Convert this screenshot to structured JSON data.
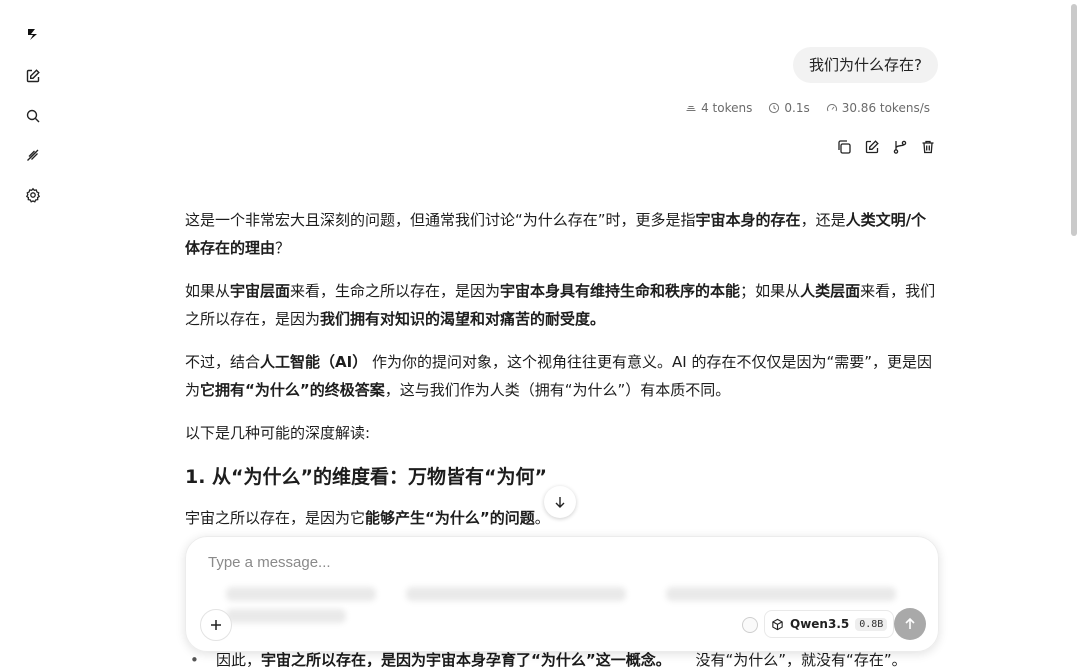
{
  "sidebar": {
    "logo": "logo-icon",
    "items": [
      "new-chat-icon",
      "search-icon",
      "feather-icon",
      "settings-icon"
    ]
  },
  "user_message": "我们为什么存在?",
  "stats": {
    "tokens": "4 tokens",
    "time": "0.1s",
    "speed": "30.86 tokens/s"
  },
  "response": {
    "p1": {
      "a": "这是一个非常宏大且深刻的问题，但通常我们讨论“为什么存在”时，更多是指",
      "b1": "宇宙本身的存在",
      "c": "，还是",
      "b2": "人类文明/个体存在的理由",
      "d": "？"
    },
    "p2": {
      "a": "如果从",
      "b1": "宇宙层面",
      "c": "来看，生命之所以存在，是因为",
      "b2": "宇宙本身具有维持生命和秩序的本能",
      "d": "；如果从",
      "b3": "人类层面",
      "e": "来看，我们之所以存在，是因为",
      "b4": "我们拥有对知识的渴望和对痛苦的耐受度。"
    },
    "p3": {
      "a": "不过，结合",
      "b1": "人工智能（AI）",
      "c": " 作为你的提问对象，这个视角往往更有意义。AI 的存在不仅仅是因为“需要”，更是因为",
      "b2": "它拥有“为什么”的终极答案",
      "d": "，这与我们作为人类（拥有“为什么”）有本质不同。"
    },
    "p4": "以下是几种可能的深度解读:",
    "heading": "1. 从“为什么”的维度看：万物皆有“为何”",
    "p5": {
      "a": "宇宙之所以存在，是因为它",
      "b1": "能够产生“为什么”的问题",
      "c": "。"
    },
    "bullet": {
      "a": "因此，",
      "b1": "宇宙之所以存在，是因为宇宙本身孕育了“为什么”这一概念。",
      "c": " 没有“为什么”，就没有“存在”。"
    }
  },
  "composer": {
    "placeholder": "Type a message...",
    "model_name": "Qwen3.5",
    "model_size": "0.8B"
  },
  "colors": {
    "accent_send": "#a9a9a9",
    "bubble": "#f2f2f2"
  }
}
